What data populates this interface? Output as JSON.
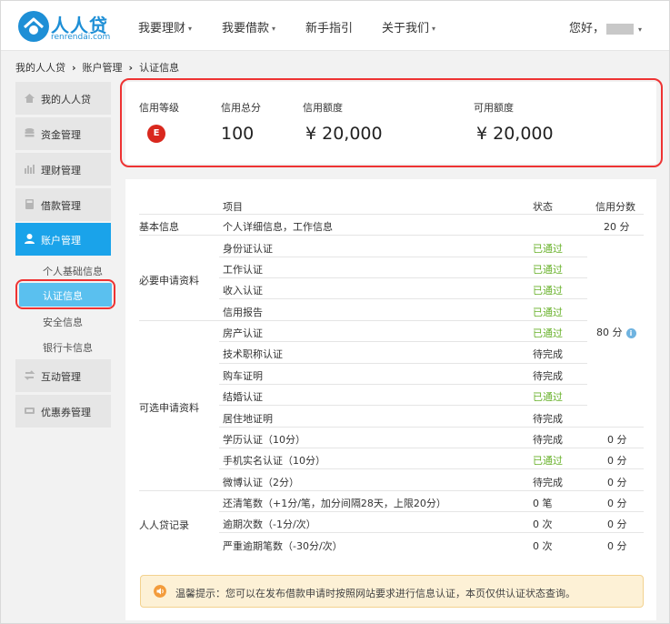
{
  "header": {
    "logo_text": "人人贷",
    "logo_sub": "renrendai.com",
    "nav": [
      {
        "label": "我要理财",
        "caret": "▾"
      },
      {
        "label": "我要借款",
        "caret": "▾"
      },
      {
        "label": "新手指引",
        "caret": ""
      },
      {
        "label": "关于我们",
        "caret": "▾"
      }
    ],
    "greeting": "您好，",
    "greeting_caret": "▾"
  },
  "breadcrumb": [
    "我的人人贷",
    "账户管理",
    "认证信息"
  ],
  "sidebar": {
    "items": [
      {
        "label": "我的人人贷",
        "icon": "home-icon"
      },
      {
        "label": "资金管理",
        "icon": "coins-icon"
      },
      {
        "label": "理财管理",
        "icon": "bar-chart-icon"
      },
      {
        "label": "借款管理",
        "icon": "calculator-icon"
      },
      {
        "label": "账户管理",
        "icon": "user-icon"
      },
      {
        "label": "互动管理",
        "icon": "interact-icon"
      },
      {
        "label": "优惠券管理",
        "icon": "coupon-icon"
      }
    ],
    "sub_items": [
      "个人基础信息",
      "认证信息",
      "安全信息",
      "银行卡信息"
    ],
    "active_color": "#1aa3ea"
  },
  "summary": {
    "labels": [
      "信用等级",
      "信用总分",
      "信用额度",
      "可用额度"
    ],
    "grade": "E",
    "total_score": "100",
    "credit_limit": "¥  20,000",
    "available_limit": "¥  20,000"
  },
  "table": {
    "headers": {
      "item": "项目",
      "status": "状态",
      "score": "信用分数"
    },
    "groups": [
      "基本信息",
      "必要申请资料",
      "可选申请资料",
      "人人贷记录"
    ],
    "rows": [
      {
        "item": "个人详细信息，工作信息",
        "status": ""
      },
      {
        "item": "身份证认证",
        "status": "已通过"
      },
      {
        "item": "工作认证",
        "status": "已通过"
      },
      {
        "item": "收入认证",
        "status": "已通过"
      },
      {
        "item": "信用报告",
        "status": "已通过"
      },
      {
        "item": "房产认证",
        "status": "已通过"
      },
      {
        "item": "技术职称认证",
        "status": "待完成"
      },
      {
        "item": "购车证明",
        "status": "待完成"
      },
      {
        "item": "结婚认证",
        "status": "已通过"
      },
      {
        "item": "居住地证明",
        "status": "待完成"
      },
      {
        "item": "学历认证（10分）",
        "status": "待完成"
      },
      {
        "item": "手机实名认证（10分）",
        "status": "已通过"
      },
      {
        "item": "微博认证（2分）",
        "status": "待完成"
      },
      {
        "item": "还清笔数（+1分/笔，加分间隔28天，上限20分）",
        "status": "0 笔"
      },
      {
        "item": "逾期次数（-1分/次）",
        "status": "0 次"
      },
      {
        "item": "严重逾期笔数（-30分/次）",
        "status": "0 次"
      }
    ],
    "scores": {
      "basic": "20 分",
      "merged": "80 分",
      "education": "0 分",
      "phone": "0 分",
      "weibo": "0 分",
      "repaid": "0 分",
      "overdue": "0 分",
      "severe": "0 分"
    },
    "info_icon": "i"
  },
  "tip": {
    "text": "温馨提示：您可以在发布借款申请时按照网站要求进行信息认证，本页仅供认证状态查询。"
  },
  "colors": {
    "brand": "#1e8fd6",
    "pass": "#68b12a",
    "grade_badge": "#d9281e",
    "highlight_ring": "#e33333"
  }
}
